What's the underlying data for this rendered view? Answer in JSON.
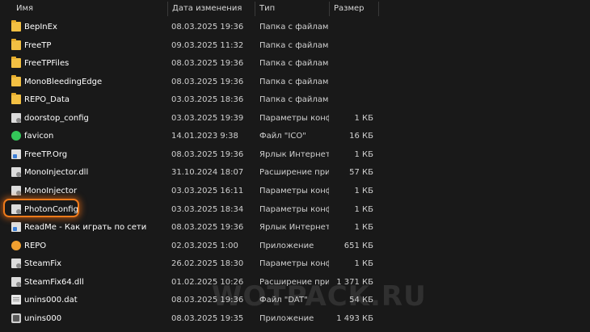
{
  "columns": {
    "name": "Имя",
    "date": "Дата изменения",
    "type": "Тип",
    "size": "Размер"
  },
  "files": [
    {
      "name": "BepInEx",
      "date": "08.03.2025 19:36",
      "type": "Папка с файлами",
      "size": "",
      "icon": "folder-icon"
    },
    {
      "name": "FreeTP",
      "date": "09.03.2025 11:32",
      "type": "Папка с файлами",
      "size": "",
      "icon": "folder-icon"
    },
    {
      "name": "FreeTPFiles",
      "date": "08.03.2025 19:36",
      "type": "Папка с файлами",
      "size": "",
      "icon": "folder-icon"
    },
    {
      "name": "MonoBleedingEdge",
      "date": "08.03.2025 19:36",
      "type": "Папка с файлами",
      "size": "",
      "icon": "folder-icon"
    },
    {
      "name": "REPO_Data",
      "date": "03.03.2025 18:36",
      "type": "Папка с файлами",
      "size": "",
      "icon": "folder-icon"
    },
    {
      "name": "doorstop_config",
      "date": "03.03.2025 19:39",
      "type": "Параметры конф...",
      "size": "1 КБ",
      "icon": "config-file-icon"
    },
    {
      "name": "favicon",
      "date": "14.01.2023 9:38",
      "type": "Файл \"ICO\"",
      "size": "16 КБ",
      "icon": "favicon-icon"
    },
    {
      "name": "FreeTP.Org",
      "date": "08.03.2025 19:36",
      "type": "Ярлык Интернета",
      "size": "1 КБ",
      "icon": "shortcut-icon"
    },
    {
      "name": "MonoInjector.dll",
      "date": "31.10.2024 18:07",
      "type": "Расширение при...",
      "size": "57 КБ",
      "icon": "dll-file-icon"
    },
    {
      "name": "MonoInjector",
      "date": "03.03.2025 16:11",
      "type": "Параметры конф...",
      "size": "1 КБ",
      "icon": "config-file-icon"
    },
    {
      "name": "PhotonConfig",
      "date": "03.03.2025 18:34",
      "type": "Параметры конф...",
      "size": "1 КБ",
      "icon": "config-file-icon"
    },
    {
      "name": "ReadMe - Как играть по сети",
      "date": "08.03.2025 19:36",
      "type": "Ярлык Интернета",
      "size": "1 КБ",
      "icon": "shortcut-icon"
    },
    {
      "name": "REPO",
      "date": "02.03.2025 1:00",
      "type": "Приложение",
      "size": "651 КБ",
      "icon": "app-icon"
    },
    {
      "name": "SteamFix",
      "date": "26.02.2025 18:30",
      "type": "Параметры конф...",
      "size": "1 КБ",
      "icon": "config-file-icon"
    },
    {
      "name": "SteamFix64.dll",
      "date": "01.02.2025 10:26",
      "type": "Расширение при...",
      "size": "1 371 КБ",
      "icon": "dll-file-icon"
    },
    {
      "name": "unins000.dat",
      "date": "08.03.2025 19:36",
      "type": "Файл \"DAT\"",
      "size": "54 КБ",
      "icon": "dat-file-icon"
    },
    {
      "name": "unins000",
      "date": "08.03.2025 19:35",
      "type": "Приложение",
      "size": "1 493 КБ",
      "icon": "uninstaller-icon"
    }
  ],
  "watermark": "WOTPACK.RU",
  "colors": {
    "background": "#191919",
    "highlight": "#f07a1a",
    "folder": "#f3c043"
  }
}
